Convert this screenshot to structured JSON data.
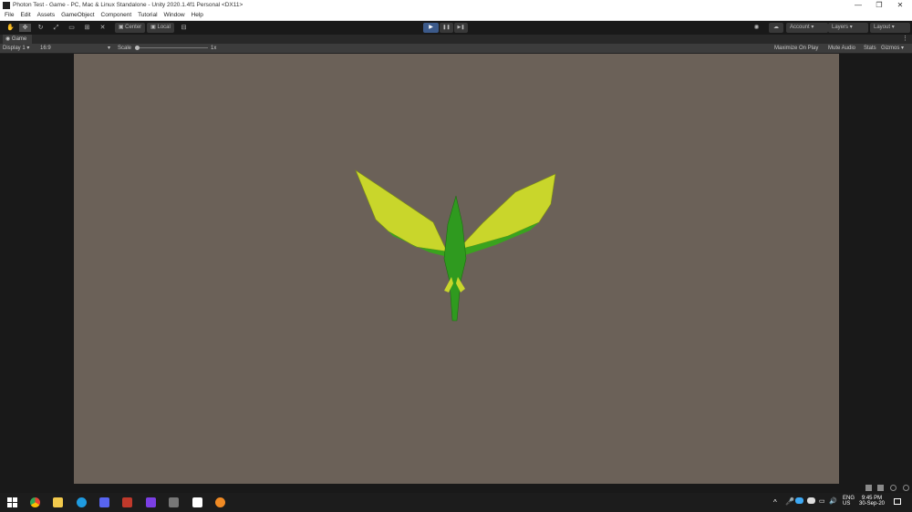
{
  "window": {
    "title": "Photon Test - Game - PC, Mac & Linux Standalone - Unity 2020.1.4f1 Personal <DX11>",
    "minimize_glyph": "—",
    "restore_glyph": "❐",
    "close_glyph": "✕"
  },
  "menu": {
    "items": [
      "File",
      "Edit",
      "Assets",
      "GameObject",
      "Component",
      "Tutorial",
      "Window",
      "Help"
    ]
  },
  "toolbar": {
    "tools": [
      "hand-icon",
      "move-icon",
      "rotate-icon",
      "scale-icon",
      "rect-icon",
      "transform-icon",
      "custom-tool-icon"
    ],
    "pivot_label": "Center",
    "space_label": "Local",
    "play_glyph": "▶",
    "pause_glyph": "❚❚",
    "step_glyph": "▶❚",
    "account_label": "Account",
    "layers_label": "Layers",
    "layout_label": "Layout"
  },
  "tab": {
    "label": "Game",
    "menu_glyph": "⋮"
  },
  "game_bar": {
    "display": "Display 1",
    "aspect": "16:9",
    "scale_label": "Scale",
    "scale_value": "1x",
    "maximize": "Maximize On Play",
    "mute": "Mute Audio",
    "stats": "Stats",
    "gizmos": "Gizmos"
  },
  "taskbar": {
    "apps": [
      "windows-start-icon",
      "chrome-icon",
      "file-explorer-icon",
      "edge-icon",
      "discord-icon",
      "app-icon-red",
      "twitch-icon",
      "app-icon-gray",
      "unity-icon",
      "blender-icon"
    ],
    "language": "ENG",
    "region": "US",
    "time": "9:45 PM",
    "date": "30-Sep-20"
  },
  "colors": {
    "viewport_bg": "#6b6158",
    "accent_play": "#3c5a8a",
    "dragon_green": "#2f9a1f",
    "wing_yellow": "#c7d62c"
  }
}
